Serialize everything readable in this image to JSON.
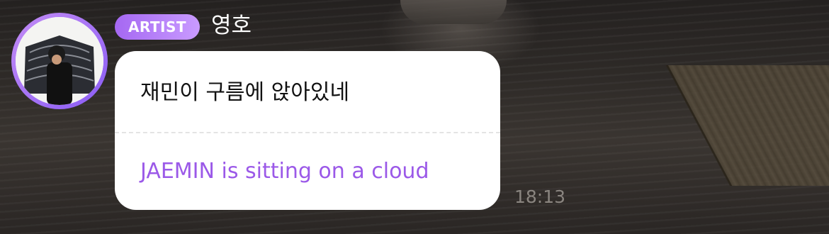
{
  "sender": {
    "badge": "ARTIST",
    "name": "영호"
  },
  "message": {
    "original": "재민이 구름에 앉아있네",
    "translation": "JAEMIN is sitting on a cloud",
    "time": "18:13"
  },
  "colors": {
    "accent": "#9b59e8",
    "badge_gradient_start": "#a568f2",
    "badge_gradient_end": "#c99bff",
    "bubble": "#ffffff"
  },
  "icons": {
    "avatar": "profile-photo"
  }
}
